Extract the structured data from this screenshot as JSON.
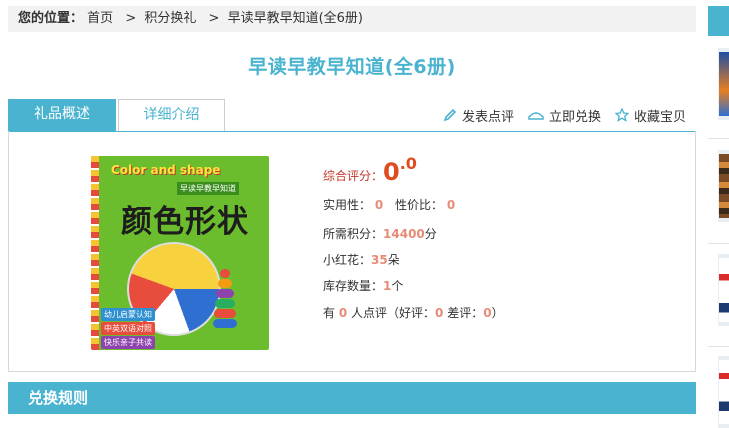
{
  "breadcrumb": {
    "label": "您的位置：",
    "home": "首页",
    "sep1": ">",
    "category": "积分换礼",
    "sep2": ">",
    "current": "早读早教早知道(全6册)"
  },
  "product": {
    "title": "早读早教早知道(全6册)"
  },
  "tabs": [
    {
      "label": "礼品概述",
      "active": true
    },
    {
      "label": "详细介绍",
      "active": false
    }
  ],
  "actions": {
    "review": "发表点评",
    "redeem": "立即兑换",
    "favorite": "收藏宝贝"
  },
  "cover": {
    "english_title": "Color and shape",
    "series": "早读早教早知道",
    "cn_title": "颜色形状",
    "tags": [
      "幼儿启蒙认知",
      "中英双语对照",
      "快乐亲子共读"
    ]
  },
  "info": {
    "score_label": "综合评分：",
    "score_int": "0",
    "score_dec": ".0",
    "practicality_label": "实用性：",
    "practicality": "0",
    "value_label": "性价比：",
    "value": "0",
    "points_label": "所需积分：",
    "points": "14400",
    "points_unit": "分",
    "flowers_label": "小红花：",
    "flowers": "35",
    "flowers_unit": "朵",
    "stock_label": "库存数量：",
    "stock": "1",
    "stock_unit": "个",
    "reviews_prefix": "有",
    "reviews_count": "0",
    "reviews_mid": "人点评（好评：",
    "good": "0",
    "bad_label": "差评：",
    "bad": "0",
    "reviews_suffix": "）"
  },
  "rules": {
    "title": "兑换规则"
  },
  "colors": {
    "accent": "#4ab3cf",
    "score": "#e04a1f",
    "value_highlight": "#e88b76"
  }
}
